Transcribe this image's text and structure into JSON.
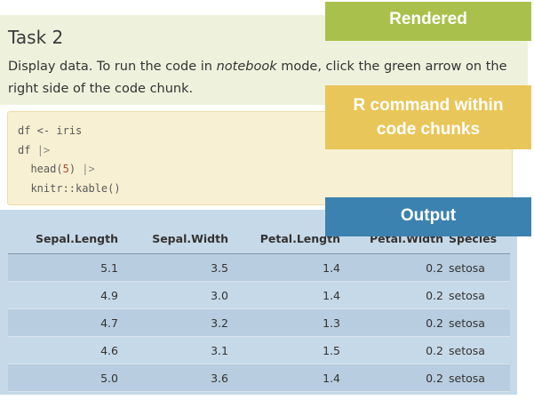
{
  "task": {
    "title": "Task 2",
    "desc_part1": "Display data. To run the code in ",
    "desc_emph": "notebook",
    "desc_part2": " mode, click the green arrow on the right side of the code chunk."
  },
  "code": {
    "line1": "df <- iris",
    "line2_a": "df ",
    "line2_pipe": "|>",
    "line3_a": "  head(",
    "line3_num": "5",
    "line3_b": ") ",
    "line3_pipe": "|>",
    "line4": "  knitr::kable()"
  },
  "table": {
    "headers": [
      "Sepal.Length",
      "Sepal.Width",
      "Petal.Length",
      "Petal.Width",
      "Species"
    ],
    "rows": [
      [
        "5.1",
        "3.5",
        "1.4",
        "0.2",
        "setosa"
      ],
      [
        "4.9",
        "3.0",
        "1.4",
        "0.2",
        "setosa"
      ],
      [
        "4.7",
        "3.2",
        "1.3",
        "0.2",
        "setosa"
      ],
      [
        "4.6",
        "3.1",
        "1.5",
        "0.2",
        "setosa"
      ],
      [
        "5.0",
        "3.6",
        "1.4",
        "0.2",
        "setosa"
      ]
    ]
  },
  "callouts": {
    "rendered": "Rendered",
    "rcmd_line1": "R command within",
    "rcmd_line2": "code chunks",
    "output": "Output"
  },
  "colors": {
    "rendered_bg": "#eef2dc",
    "code_bg": "#f7f0d2",
    "output_bg": "#c6d9e8",
    "callout_rendered": "#a9c14c",
    "callout_rcmd": "#e9c659",
    "callout_output": "#3c82b0"
  }
}
